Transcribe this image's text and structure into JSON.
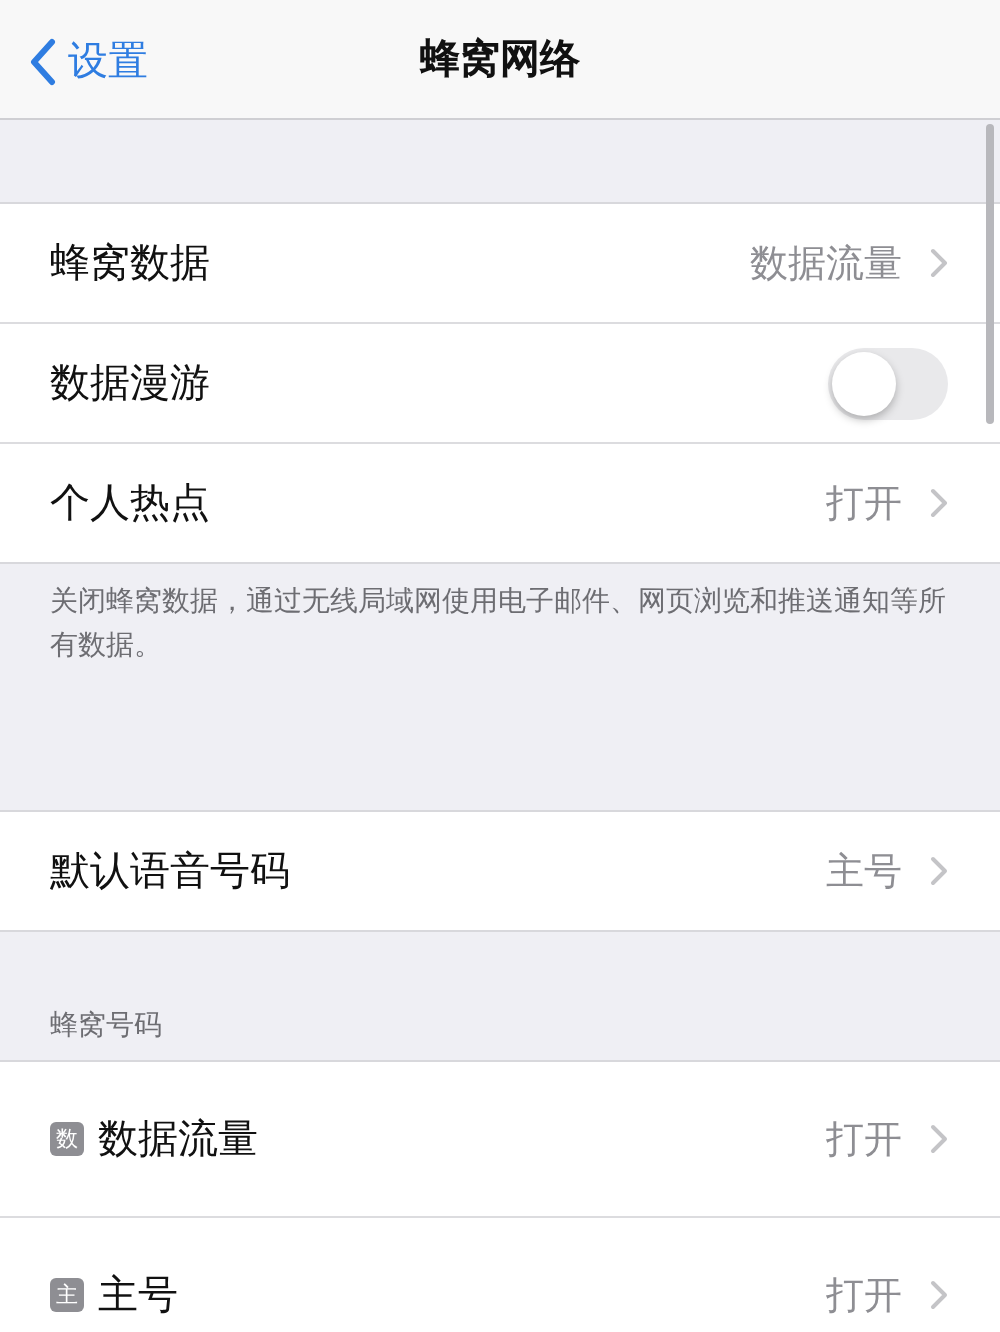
{
  "nav": {
    "back_label": "设置",
    "title": "蜂窝网络"
  },
  "groups": [
    {
      "rows": [
        {
          "kind": "link",
          "label": "蜂窝数据",
          "value": "数据流量"
        },
        {
          "kind": "toggle",
          "label": "数据漫游",
          "on": false
        },
        {
          "kind": "link",
          "label": "个人热点",
          "value": "打开"
        }
      ],
      "footer": "关闭蜂窝数据，通过无线局域网使用电子邮件、网页浏览和推送通知等所有数据。"
    },
    {
      "rows": [
        {
          "kind": "link",
          "label": "默认语音号码",
          "value": "主号"
        }
      ]
    },
    {
      "header": "蜂窝号码",
      "rows": [
        {
          "kind": "sim",
          "badge": "数",
          "label": "数据流量",
          "value": "打开"
        },
        {
          "kind": "sim",
          "badge": "主",
          "label": "主号",
          "value": "打开"
        }
      ]
    }
  ]
}
